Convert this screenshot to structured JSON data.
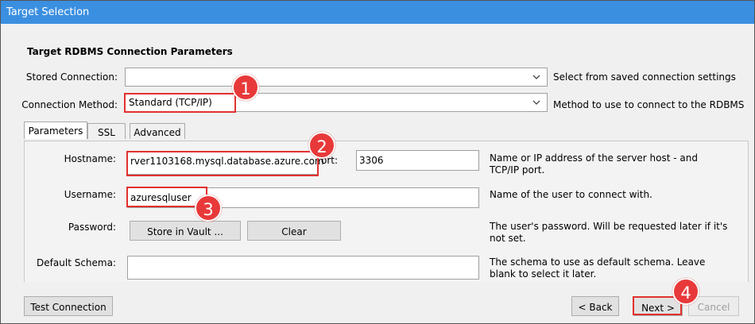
{
  "window": {
    "title": "Target Selection"
  },
  "section_heading": "Target RDBMS Connection Parameters",
  "stored_connection": {
    "label": "Stored Connection:",
    "value": "",
    "description": "Select from saved connection settings"
  },
  "connection_method": {
    "label": "Connection Method:",
    "value": "Standard (TCP/IP)",
    "description": "Method to use to connect to the RDBMS"
  },
  "tabs": [
    {
      "label": "Parameters",
      "active": true
    },
    {
      "label": "SSL",
      "active": false
    },
    {
      "label": "Advanced",
      "active": false
    }
  ],
  "parameters": {
    "hostname": {
      "label": "Hostname:",
      "value": "rver1103168.mysql.database.azure.com",
      "port_label": "ort:",
      "port_value": "3306",
      "description_line1": "Name or IP address of the server host - and",
      "description_line2": "TCP/IP port."
    },
    "username": {
      "label": "Username:",
      "value": "azuresqluser",
      "description": "Name of the user to connect with."
    },
    "password": {
      "label": "Password:",
      "store_button": "Store in Vault ...",
      "clear_button": "Clear",
      "description_line1": "The user's password. Will be requested later if it's",
      "description_line2": "not set."
    },
    "default_schema": {
      "label": "Default Schema:",
      "value": "",
      "description_line1": "The schema to use as default schema. Leave",
      "description_line2": "blank to select it later."
    }
  },
  "footer": {
    "test_connection": "Test Connection",
    "back": "< Back",
    "next": "Next >",
    "cancel": "Cancel"
  },
  "callouts": [
    "1",
    "2",
    "3",
    "4"
  ],
  "colors": {
    "title_bar": "#3b8fe0",
    "highlight": "#e2312e",
    "badge": "#e8393a"
  }
}
